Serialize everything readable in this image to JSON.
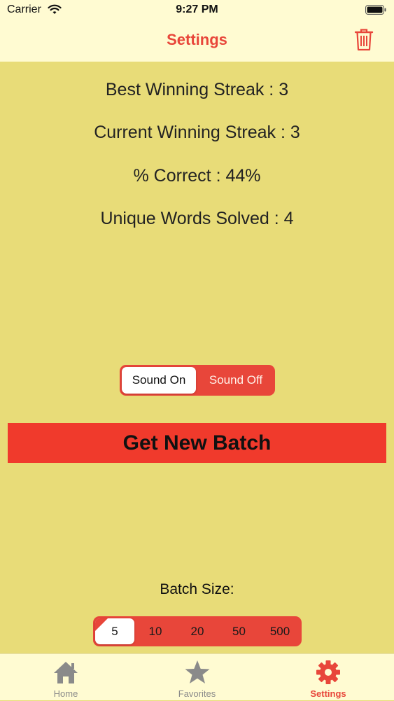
{
  "status_bar": {
    "carrier": "Carrier",
    "time": "9:27 PM"
  },
  "nav": {
    "title": "Settings",
    "trash_icon": "trash-icon"
  },
  "stats": [
    {
      "text": "Best Winning Streak :  3"
    },
    {
      "text": "Current Winning Streak :  3"
    },
    {
      "text": "% Correct :  44%"
    },
    {
      "text": "Unique Words Solved :  4"
    }
  ],
  "sound_toggle": {
    "on_label": "Sound On",
    "off_label": "Sound Off",
    "selected": "Sound On"
  },
  "batch_button": {
    "label": "Get New Batch"
  },
  "batch_size": {
    "label": "Batch Size:",
    "options": [
      "5",
      "10",
      "20",
      "50",
      "500"
    ],
    "selected": "5"
  },
  "tab_bar": {
    "items": [
      {
        "label": "Home",
        "icon": "home-icon"
      },
      {
        "label": "Favorites",
        "icon": "star-icon"
      },
      {
        "label": "Settings",
        "icon": "gear-icon"
      }
    ],
    "active": "Settings"
  },
  "colors": {
    "background": "#e8dc78",
    "bar_background": "#fffbd2",
    "accent": "#e8463a",
    "button_red": "#f03a2c"
  }
}
